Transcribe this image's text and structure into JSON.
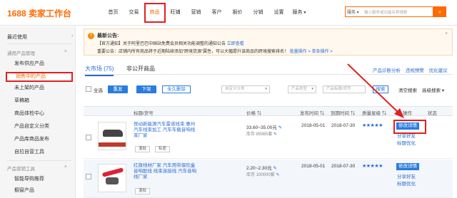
{
  "topbar": {
    "logo": "1688 卖家工作台",
    "nav": [
      "首页",
      "交易",
      "商品",
      "旺铺",
      "营销",
      "客户",
      "报价",
      "分销",
      "设置",
      "服务"
    ],
    "active_index": 2,
    "search_select": "服务",
    "search_placeholder": "输入服务或功能名称搜索"
  },
  "sidebar": {
    "recent": "最近使用",
    "group1": "通用产品管理",
    "items": [
      "发布供应产品",
      "销售中的产品",
      "未上架的产品",
      "草稿箱",
      "商品体检中心",
      "产品自定义分类",
      "产品库商品发布",
      "自拉自营工具"
    ],
    "active_index": 1,
    "group2": "产品营销工具",
    "items2": [
      "智能导购推荐",
      "橱窗产品"
    ]
  },
  "notice": {
    "title": "最新公告:",
    "line1_prefix": "【官方通知】关于阿里巴巴中国站免费会员相关功能调整的通知公告",
    "line1_link": "立即查看",
    "line2_text": "重要公告：店铺内所有商品将于近期陆续添加“跨境货源”属性，可以大幅提升该商品的跨境搜索排名！",
    "line2_link": "批量操作 > 单条操作 >"
  },
  "tabs": {
    "tab1": "大市场 (75)",
    "tab2": "非公开商品",
    "links": [
      "产品诊断分析",
      "违规预警",
      "优化建议"
    ]
  },
  "toolbar": {
    "select_all": "全选",
    "btn_refresh": "重发",
    "btn_offline": "下架",
    "btn_delete": "永久删除",
    "sel_category": "自定义分类",
    "sel_type": "产品类型",
    "search_placeholder": "产品标题/货号",
    "search_btn": "搜索",
    "clear": "清空搜索",
    "advanced": "高级搜索"
  },
  "table": {
    "headers": [
      "标题/货号",
      "价格",
      "发布时间",
      "到期时间",
      "质量星级",
      "操作",
      "状态"
    ],
    "rows": [
      {
        "title": "悦动新能源汽车雷诺线束 惠州汽车线束加工 汽车车载音响线束厂家",
        "tag1": "混批",
        "tag2": "私密",
        "price": "33.60~35.00元",
        "stock": "库存 89985套",
        "publish": "2018-05-01",
        "expire": "2018-07-30",
        "stars": "★★★★★",
        "op_btn": "修改详情",
        "op_link1": "分享好友",
        "op_link2": "标题优化"
      },
      {
        "title": "红旗线材厂家 汽车用带保险盒音响配线 线束连接线 汽车音响线厂家",
        "tag1": "混批",
        "tag2": "",
        "price": "2.20~2.30元",
        "stock": "库存 100000套",
        "publish": "2018-05-01",
        "expire": "2018-07-30",
        "stars": "★★★★★",
        "op_btn": "修改详情",
        "op_link1": "分享好友",
        "op_link2": "标题优化"
      }
    ]
  },
  "colors": {
    "accent": "#ff6a00",
    "link": "#2a6bd4",
    "highlight": "#e02020"
  }
}
